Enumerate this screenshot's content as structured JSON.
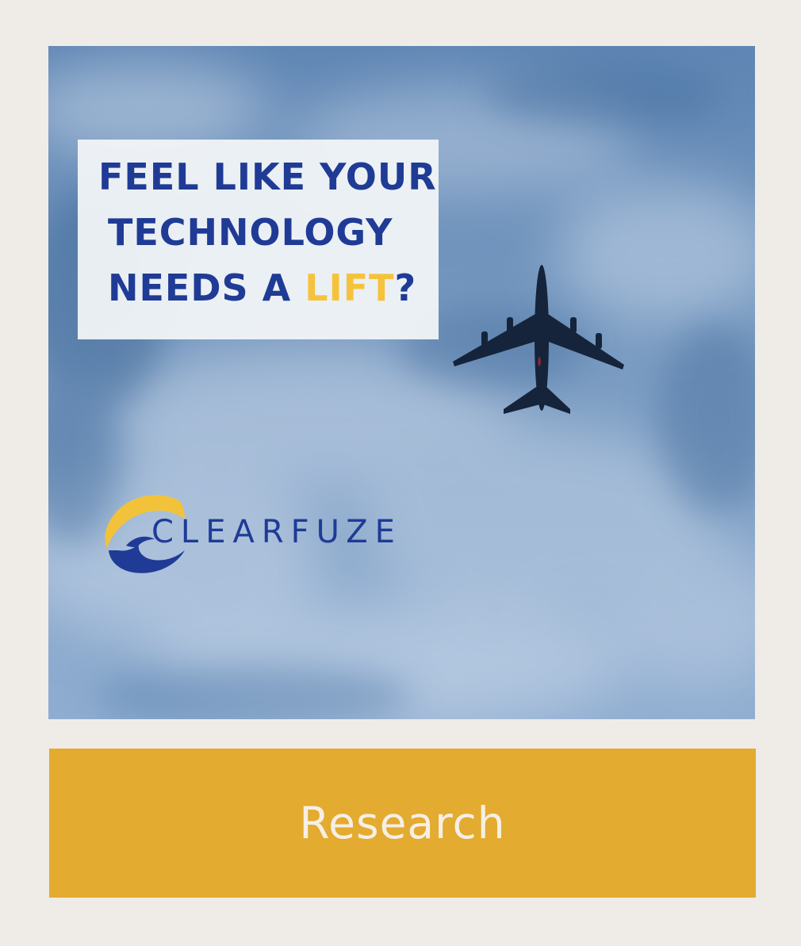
{
  "hero": {
    "headline": {
      "line1": "FEEL LIKE YOUR",
      "line2": "TECHNOLOGY",
      "line3_prefix": "NEEDS A ",
      "line3_highlight": "LIFT",
      "line3_suffix": "?"
    },
    "logo": {
      "text": "CLEARFUZE",
      "icon": "clearfuze-logo-icon"
    },
    "image_icon": "airplane-icon"
  },
  "cta": {
    "label": "Research"
  },
  "colors": {
    "background": "#efece8",
    "headline": "#1f3b96",
    "highlight": "#f5c33b",
    "cta_background": "#e3ab2f",
    "cta_text": "#f6efe6"
  }
}
